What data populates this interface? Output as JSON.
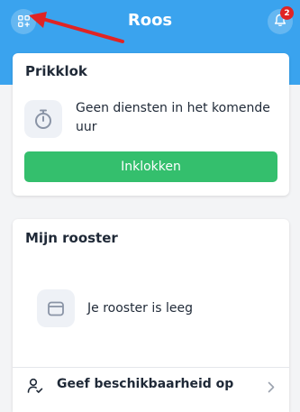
{
  "header": {
    "title": "Roos",
    "notification_count": "2",
    "background_color": "#3aa3ee",
    "left_icon": "grid-plus-icon",
    "right_icon": "bell-icon"
  },
  "annotation": {
    "arrow_color": "#e02424"
  },
  "time_clock": {
    "title": "Prikklok",
    "icon": "stopwatch-icon",
    "message": "Geen diensten in het komende uur",
    "button_label": "Inklokken",
    "button_color": "#34bf6d"
  },
  "schedule": {
    "title": "Mijn rooster",
    "icon": "calendar-icon",
    "message": "Je rooster is leeg",
    "availability_label": "Geef beschikbaarheid op",
    "availability_icon": "user-check-icon"
  }
}
